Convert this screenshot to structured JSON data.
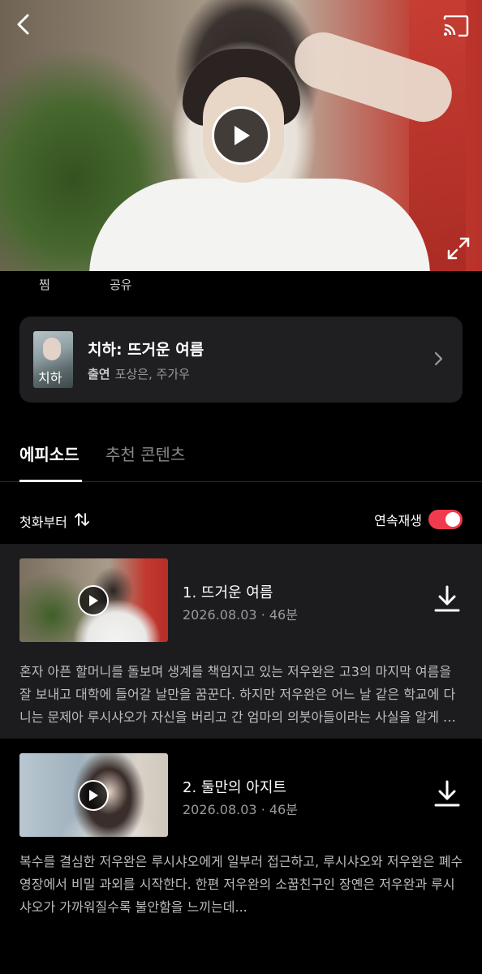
{
  "hero": {
    "icons": {
      "back": "back-arrow-icon",
      "cast": "cast-icon",
      "play": "play-icon",
      "fullscreen": "fullscreen-icon"
    }
  },
  "actions": {
    "like_label": "찜",
    "share_label": "공유"
  },
  "series": {
    "title": "치하: 뜨거운 여름",
    "cast_label": "출연",
    "cast_names": "포상은, 주가우",
    "thumb_text": "치하"
  },
  "tabs": [
    {
      "label": "에피소드",
      "active": true
    },
    {
      "label": "추천 콘텐츠",
      "active": false
    }
  ],
  "sort": {
    "label": "첫화부터"
  },
  "autoplay": {
    "label": "연속재생",
    "on": true,
    "color": "#ef3b4c"
  },
  "episodes": [
    {
      "title": "1. 뜨거운 여름",
      "date": "2026.08.03",
      "duration": "46분",
      "description": "혼자 아픈 할머니를 돌보며 생계를 책임지고 있는 저우완은 고3의 마지막 여름을 잘 보내고 대학에 들어갈 날만을 꿈꾼다. 하지만 저우완은 어느 날 같은 학교에 다니는 문제아 루시샤오가 자신을 버리고 간 엄마의 의붓아들이라는 사실을 알게 되는데..."
    },
    {
      "title": "2. 둘만의 아지트",
      "date": "2026.08.03",
      "duration": "46분",
      "description": "복수를 결심한 저우완은 루시샤오에게 일부러 접근하고, 루시샤오와 저우완은 폐수영장에서 비밀 과외를 시작한다. 한편 저우완의 소꿉친구인 장옌은 저우완과 루시샤오가 가까워질수록 불안함을 느끼는데..."
    }
  ]
}
